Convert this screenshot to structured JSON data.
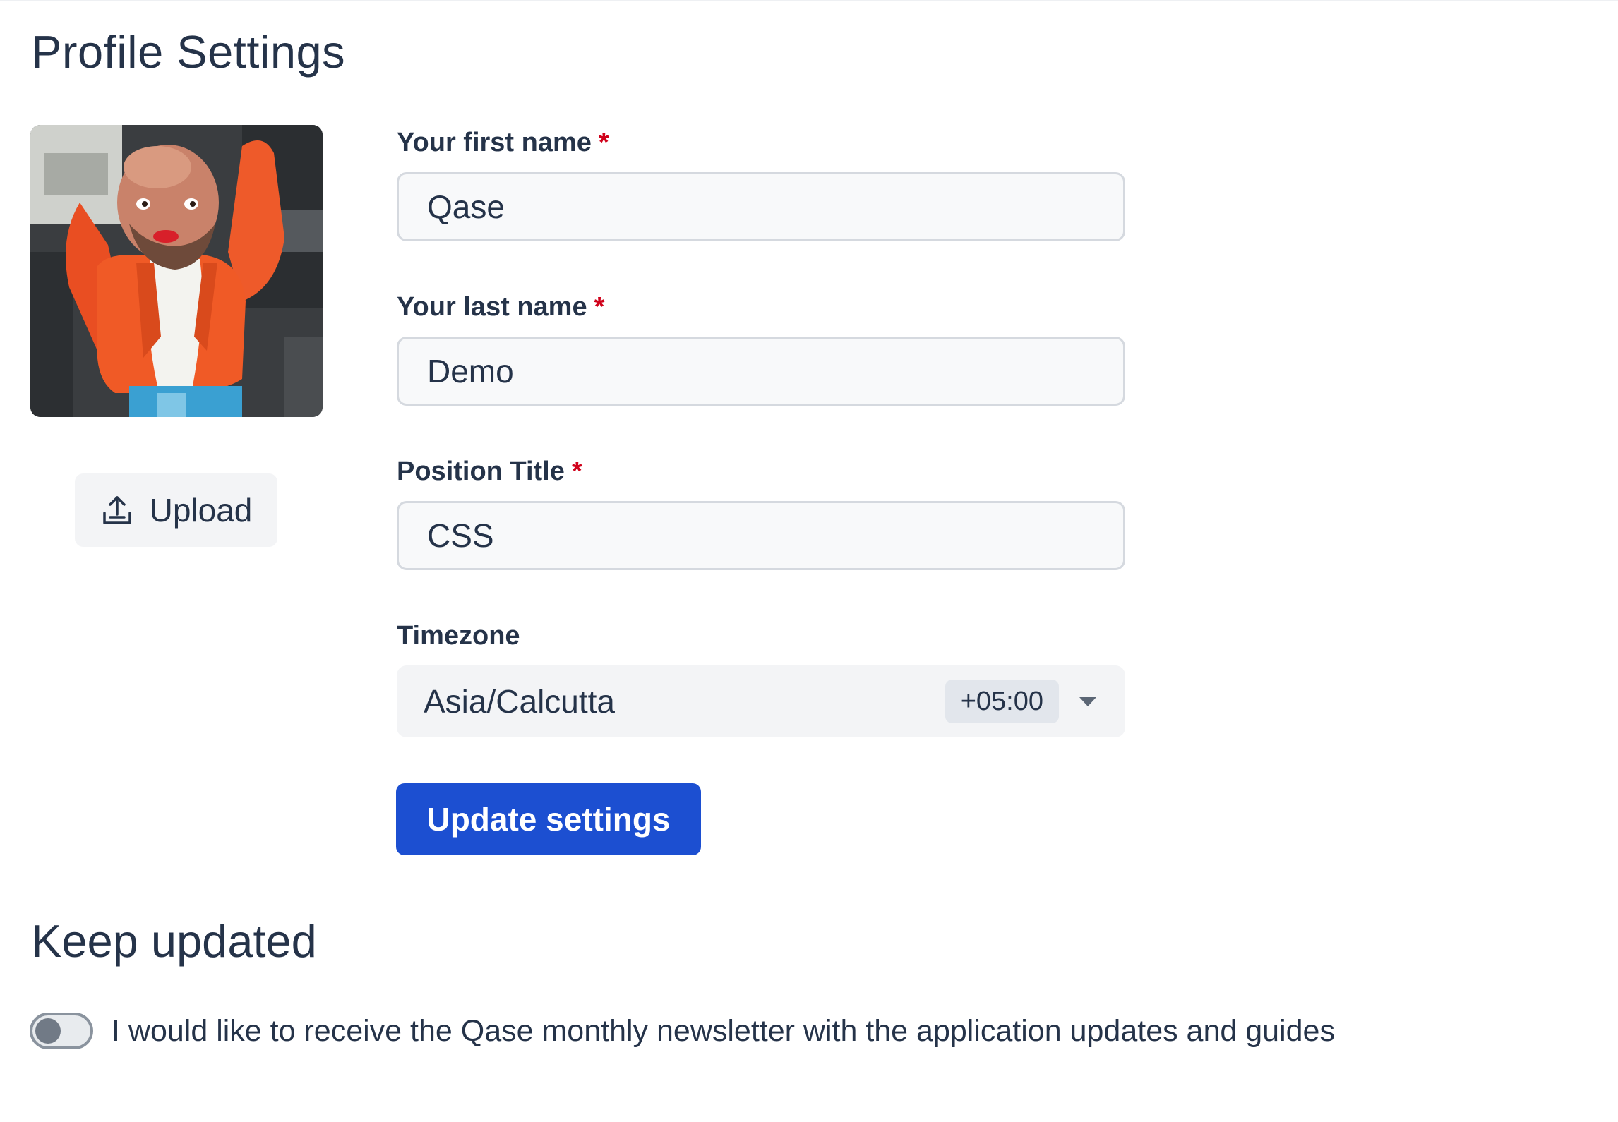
{
  "page": {
    "title": "Profile Settings"
  },
  "avatar": {
    "upload_label": "Upload"
  },
  "form": {
    "first_name": {
      "label": "Your first name",
      "required": "*",
      "value": "Qase"
    },
    "last_name": {
      "label": "Your last name",
      "required": "*",
      "value": "Demo"
    },
    "position_title": {
      "label": "Position Title",
      "required": "*",
      "value": "CSS"
    },
    "timezone": {
      "label": "Timezone",
      "value": "Asia/Calcutta",
      "offset": "+05:00"
    },
    "submit_label": "Update settings"
  },
  "keep_updated": {
    "title": "Keep updated",
    "newsletter_label": "I would like to receive the Qase monthly newsletter with the application updates and guides",
    "newsletter_enabled": false
  },
  "colors": {
    "primary": "#1c4fd1",
    "text": "#253349",
    "required": "#d0021b"
  }
}
